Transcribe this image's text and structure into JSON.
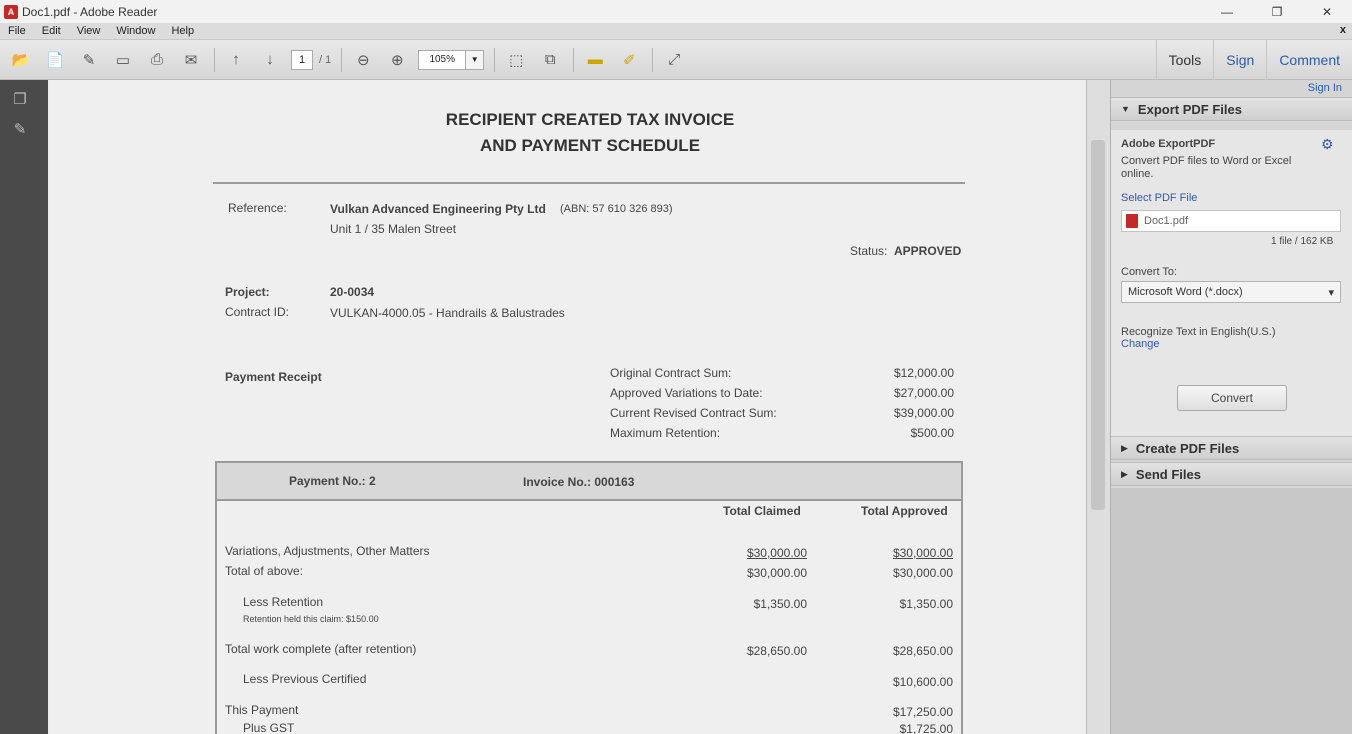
{
  "window": {
    "title": "Doc1.pdf - Adobe Reader",
    "controls": [
      "—",
      "❐",
      "✕"
    ]
  },
  "menu": {
    "items": [
      "File",
      "Edit",
      "View",
      "Window",
      "Help"
    ],
    "close": "x"
  },
  "toolbar": {
    "page_current": "1",
    "page_count": "/ 1",
    "zoom": "105%",
    "right": {
      "tools": "Tools",
      "sign": "Sign",
      "comment": "Comment"
    }
  },
  "document": {
    "title_line1": "RECIPIENT CREATED TAX INVOICE",
    "title_line2": "AND PAYMENT SCHEDULE",
    "reference_label": "Reference:",
    "reference_company": "Vulkan Advanced Engineering Pty Ltd",
    "reference_abn": "(ABN: 57 610 326 893)",
    "reference_address": "Unit 1 / 35 Malen Street",
    "status_label": "Status:",
    "status_value": "APPROVED",
    "project_label": "Project:",
    "project_value": "20-0034",
    "contract_label": "Contract ID:",
    "contract_value": "VULKAN-4000.05 - Handrails & Balustrades",
    "payment_receipt": "Payment Receipt",
    "summary": [
      {
        "label": "Original Contract Sum:",
        "value": "$12,000.00"
      },
      {
        "label": "Approved Variations to Date:",
        "value": "$27,000.00"
      },
      {
        "label": "Current Revised Contract Sum:",
        "value": "$39,000.00"
      },
      {
        "label": "Maximum Retention:",
        "value": "$500.00"
      }
    ],
    "payment_no": "Payment No.: 2",
    "invoice_no": "Invoice No.: 000163",
    "col_claimed": "Total Claimed",
    "col_approved": "Total Approved",
    "rows": [
      {
        "label": "Variations, Adjustments, Other Matters",
        "claimed": "$30,000.00",
        "approved": "$30,000.00"
      },
      {
        "label": "Total of above:",
        "claimed": "$30,000.00",
        "approved": "$30,000.00"
      },
      {
        "label": "Less Retention",
        "claimed": "$1,350.00",
        "approved": "$1,350.00"
      },
      {
        "label": "Total work complete (after retention)",
        "claimed": "$28,650.00",
        "approved": "$28,650.00"
      },
      {
        "label": "Less Previous Certified",
        "claimed": "",
        "approved": "$10,600.00"
      },
      {
        "label": "This Payment",
        "claimed": "",
        "approved": "$17,250.00"
      },
      {
        "label": "Plus GST",
        "claimed": "",
        "approved": "$1,725.00"
      }
    ],
    "retention_note": "Retention held this claim: $150.00"
  },
  "rightpane": {
    "sign_in": "Sign In",
    "export_section": "Export PDF Files",
    "export_title": "Adobe ExportPDF",
    "export_desc_1": "Convert PDF files to Word or Excel",
    "export_desc_2": "online.",
    "select_label": "Select PDF File",
    "file_name": "Doc1.pdf",
    "file_count": "1 file / 162 KB",
    "convert_to_label": "Convert To:",
    "convert_to_value": "Microsoft Word (*.docx)",
    "recognize_text": "Recognize Text in English(U.S.)",
    "change_link": "Change",
    "convert_button": "Convert",
    "create_section": "Create PDF Files",
    "send_section": "Send Files"
  }
}
